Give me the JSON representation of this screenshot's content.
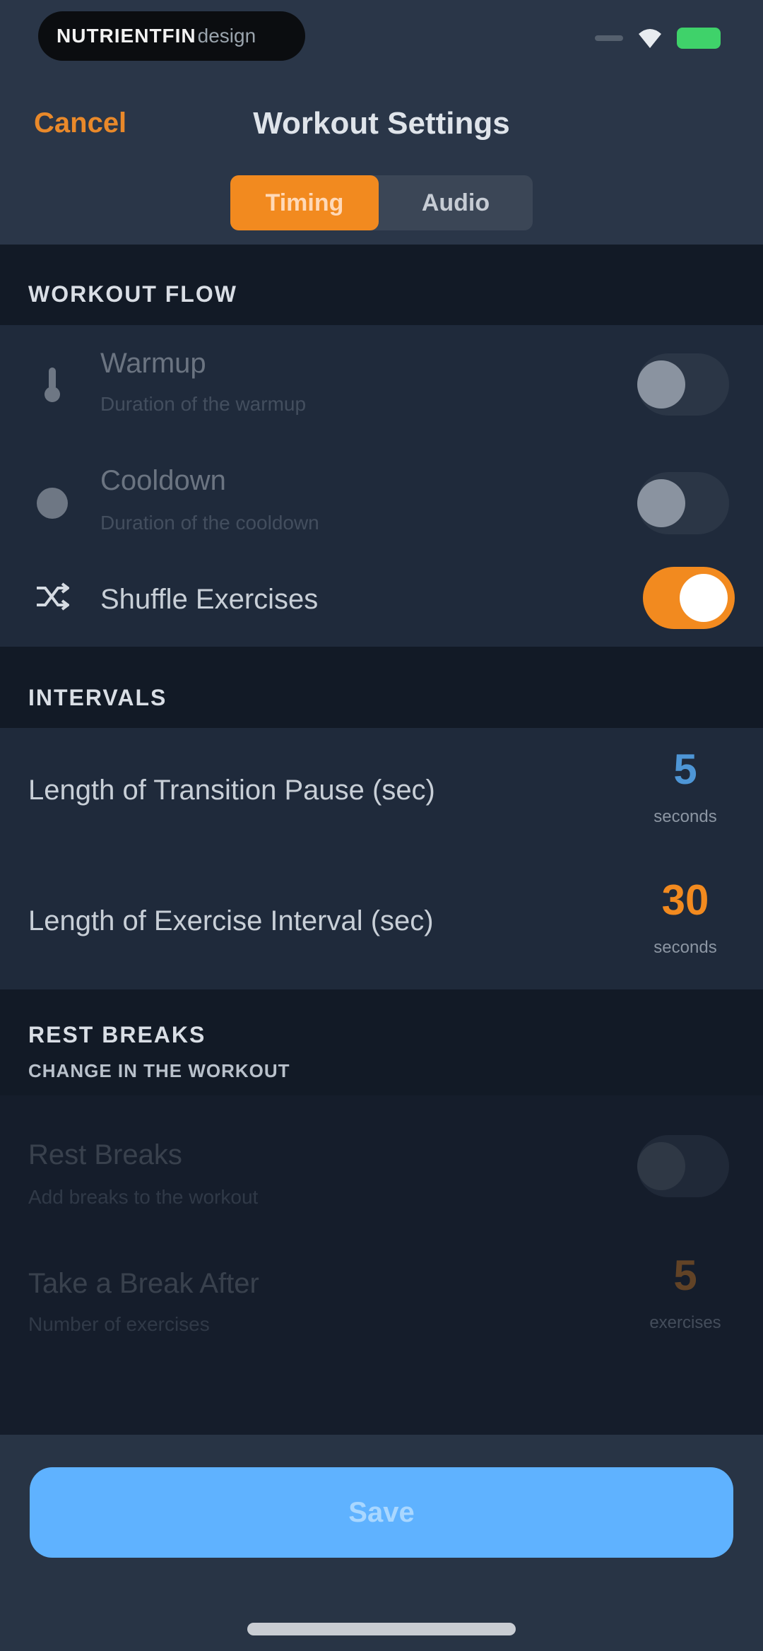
{
  "status_bar": {
    "brand_bold": "NUTRIENTFIN",
    "brand_light": "design",
    "icons": [
      "signal-icon",
      "wifi-icon",
      "battery-icon"
    ],
    "battery_color": "#3fd26a"
  },
  "nav": {
    "cancel_label": "Cancel",
    "title": "Workout Settings",
    "tabs": [
      {
        "label": "Timing",
        "active": true
      },
      {
        "label": "Audio",
        "active": false
      }
    ]
  },
  "workout_flow": {
    "header": "WORKOUT FLOW",
    "rows": [
      {
        "label": "Warmup",
        "description": "Duration of the warmup",
        "icon": "thermometer-icon",
        "toggle": false,
        "enabled": false
      },
      {
        "label": "Cooldown",
        "description": "Duration of the cooldown",
        "icon": "snowflake-icon",
        "toggle": false,
        "enabled": false
      },
      {
        "label": "Shuffle Exercises",
        "icon": "shuffle-icon",
        "toggle": true,
        "enabled": true
      }
    ]
  },
  "intervals": {
    "header": "INTERVALS",
    "rows": [
      {
        "label": "Length of Transition Pause (sec)",
        "value": "5",
        "unit": "seconds",
        "value_color": "#4e96d6"
      },
      {
        "label": "Length of Exercise Interval (sec)",
        "value": "30",
        "unit": "seconds",
        "value_color": "#f28a1f"
      }
    ]
  },
  "rest_breaks": {
    "header": "REST BREAKS",
    "subheader": "CHANGE IN THE WORKOUT",
    "rows": [
      {
        "label": "Rest Breaks",
        "description": "Add breaks to the workout",
        "toggle": false,
        "enabled": false
      },
      {
        "label": "Take a Break After",
        "description": "Number of exercises",
        "value": "5",
        "unit": "exercises",
        "enabled": false
      }
    ]
  },
  "footer": {
    "save_label": "Save",
    "save_color": "#5fb2ff"
  },
  "colors": {
    "accent": "#f28a1f",
    "background": "#1a2232",
    "header_bg": "#2a3648"
  }
}
